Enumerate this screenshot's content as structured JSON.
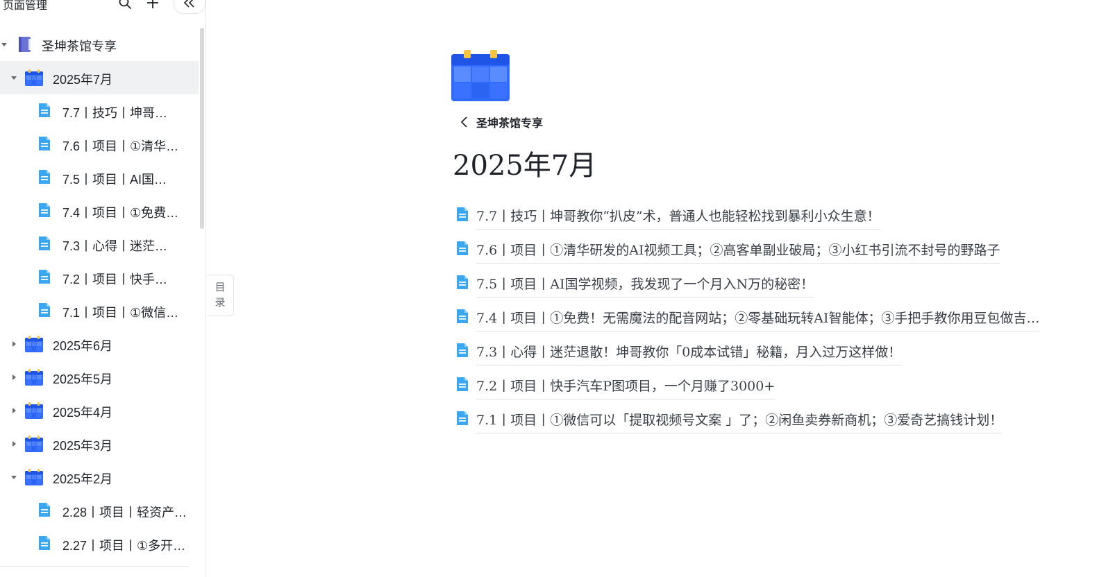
{
  "sidebar": {
    "title": "页面管理",
    "toc_label_1": "目",
    "toc_label_2": "录",
    "tree": [
      {
        "label": "圣坤茶馆专享",
        "level": 0,
        "icon": "book-icon",
        "caret": "down"
      },
      {
        "label": "2025年7月",
        "level": 1,
        "icon": "calendar-icon",
        "caret": "down",
        "selected": true
      },
      {
        "label": "7.7丨技巧丨坤哥教你“扒皮”术，普通人也能轻松找到暴利小众生意！",
        "level": 2,
        "icon": "doc-icon"
      },
      {
        "label": "7.6丨项目丨①清华研发的AI视频工具；②高客单副业破局；③小红书引流不封号的野路子",
        "level": 2,
        "icon": "doc-icon"
      },
      {
        "label": "7.5丨项目丨AI国学视频，我发现了一个月入N万的秘密！",
        "level": 2,
        "icon": "doc-icon"
      },
      {
        "label": "7.4丨项目丨①免费！无需魔法的配音网站；②零基础玩转AI智能体；③手把手教你用豆包做吉…",
        "level": 2,
        "icon": "doc-icon"
      },
      {
        "label": "7.3丨心得丨迷茫退散！坤哥教你「0成本试错」秘籍，月入过万这样做！",
        "level": 2,
        "icon": "doc-icon"
      },
      {
        "label": "7.2丨项目丨快手汽车P图项目，一个月赚了3000+",
        "level": 2,
        "icon": "doc-icon"
      },
      {
        "label": "7.1丨项目丨①微信可以「提取视频号文案 」了；②闲鱼卖券新商机；③爱奇艺搞钱计划！",
        "level": 2,
        "icon": "doc-icon"
      },
      {
        "label": "2025年6月",
        "level": 1,
        "icon": "calendar-icon",
        "caret": "right"
      },
      {
        "label": "2025年5月",
        "level": 1,
        "icon": "calendar-icon",
        "caret": "right"
      },
      {
        "label": "2025年4月",
        "level": 1,
        "icon": "calendar-icon",
        "caret": "right"
      },
      {
        "label": "2025年3月",
        "level": 1,
        "icon": "calendar-icon",
        "caret": "right"
      },
      {
        "label": "2025年2月",
        "level": 1,
        "icon": "calendar-icon",
        "caret": "down"
      },
      {
        "label": "2.28丨项目丨轻资产…",
        "level": 2,
        "icon": "doc-icon",
        "wide": true
      },
      {
        "label": "2.27丨项目丨①多开…",
        "level": 2,
        "icon": "doc-icon",
        "wide": true
      }
    ]
  },
  "main": {
    "breadcrumb": "圣坤茶馆专享",
    "title": "2025年7月",
    "children": [
      "7.7丨技巧丨坤哥教你“扒皮”术，普通人也能轻松找到暴利小众生意！",
      "7.6丨项目丨①清华研发的AI视频工具；②高客单副业破局；③小红书引流不封号的野路子",
      "7.5丨项目丨AI国学视频，我发现了一个月入N万的秘密！",
      "7.4丨项目丨①免费！无需魔法的配音网站；②零基础玩转AI智能体；③手把手教你用豆包做吉…",
      "7.3丨心得丨迷茫退散！坤哥教你「0成本试错」秘籍，月入过万这样做！",
      "7.2丨项目丨快手汽车P图项目，一个月赚了3000+",
      "7.1丨项目丨①微信可以「提取视频号文案 」了；②闲鱼卖券新商机；③爱奇艺搞钱计划！"
    ]
  },
  "colors": {
    "calendar_blue": "#2f6bff",
    "calendar_tab": "#f5c542",
    "doc_blue": "#3aa7f0",
    "book_purple": "#6b72d8",
    "selected_bg": "#f0f1f2"
  }
}
